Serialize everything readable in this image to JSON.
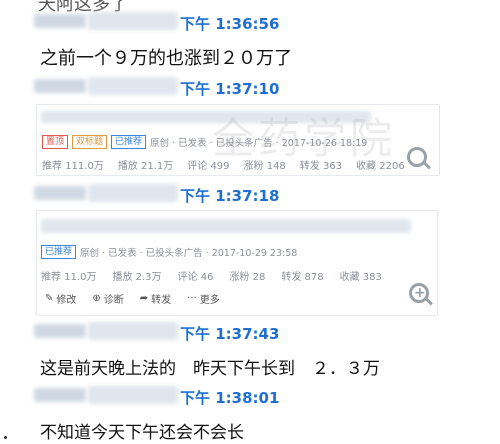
{
  "chat": {
    "messages": [
      {
        "time": "下午 1:36:56",
        "text": "之前一个９万的也涨到２０万了"
      },
      {
        "time": "下午 1:37:10"
      },
      {
        "time": "下午 1:37:18"
      },
      {
        "time": "下午 1:37:43",
        "text": "这是前天晚上法的　昨天下午长到　２．３万"
      },
      {
        "time": "下午 1:38:01",
        "text": "不知道今天下午还会不会长"
      }
    ],
    "top_partial_text": "天阿这多了"
  },
  "card1": {
    "tags": [
      "置顶",
      "双标题",
      "已推荐"
    ],
    "meta": "原创 · 已发表 · 已投头条广告 · 2017-10-26 18:19",
    "stats": [
      "推荐 111.0万",
      "播放 21.1万",
      "评论 499",
      "涨粉 148",
      "转发 363",
      "收藏 2206"
    ],
    "watermark": "全药学院"
  },
  "card2": {
    "tags": [
      "已推荐"
    ],
    "meta": "原创 · 已发表 · 已投头条广告 · 2017-10-29 23:58",
    "stats": [
      "推荐 11.0万",
      "播放 2.3万",
      "评论 46",
      "涨粉 28",
      "转发 878",
      "收藏 383"
    ],
    "actions": [
      "修改",
      "诊断",
      "转发",
      "更多"
    ]
  }
}
